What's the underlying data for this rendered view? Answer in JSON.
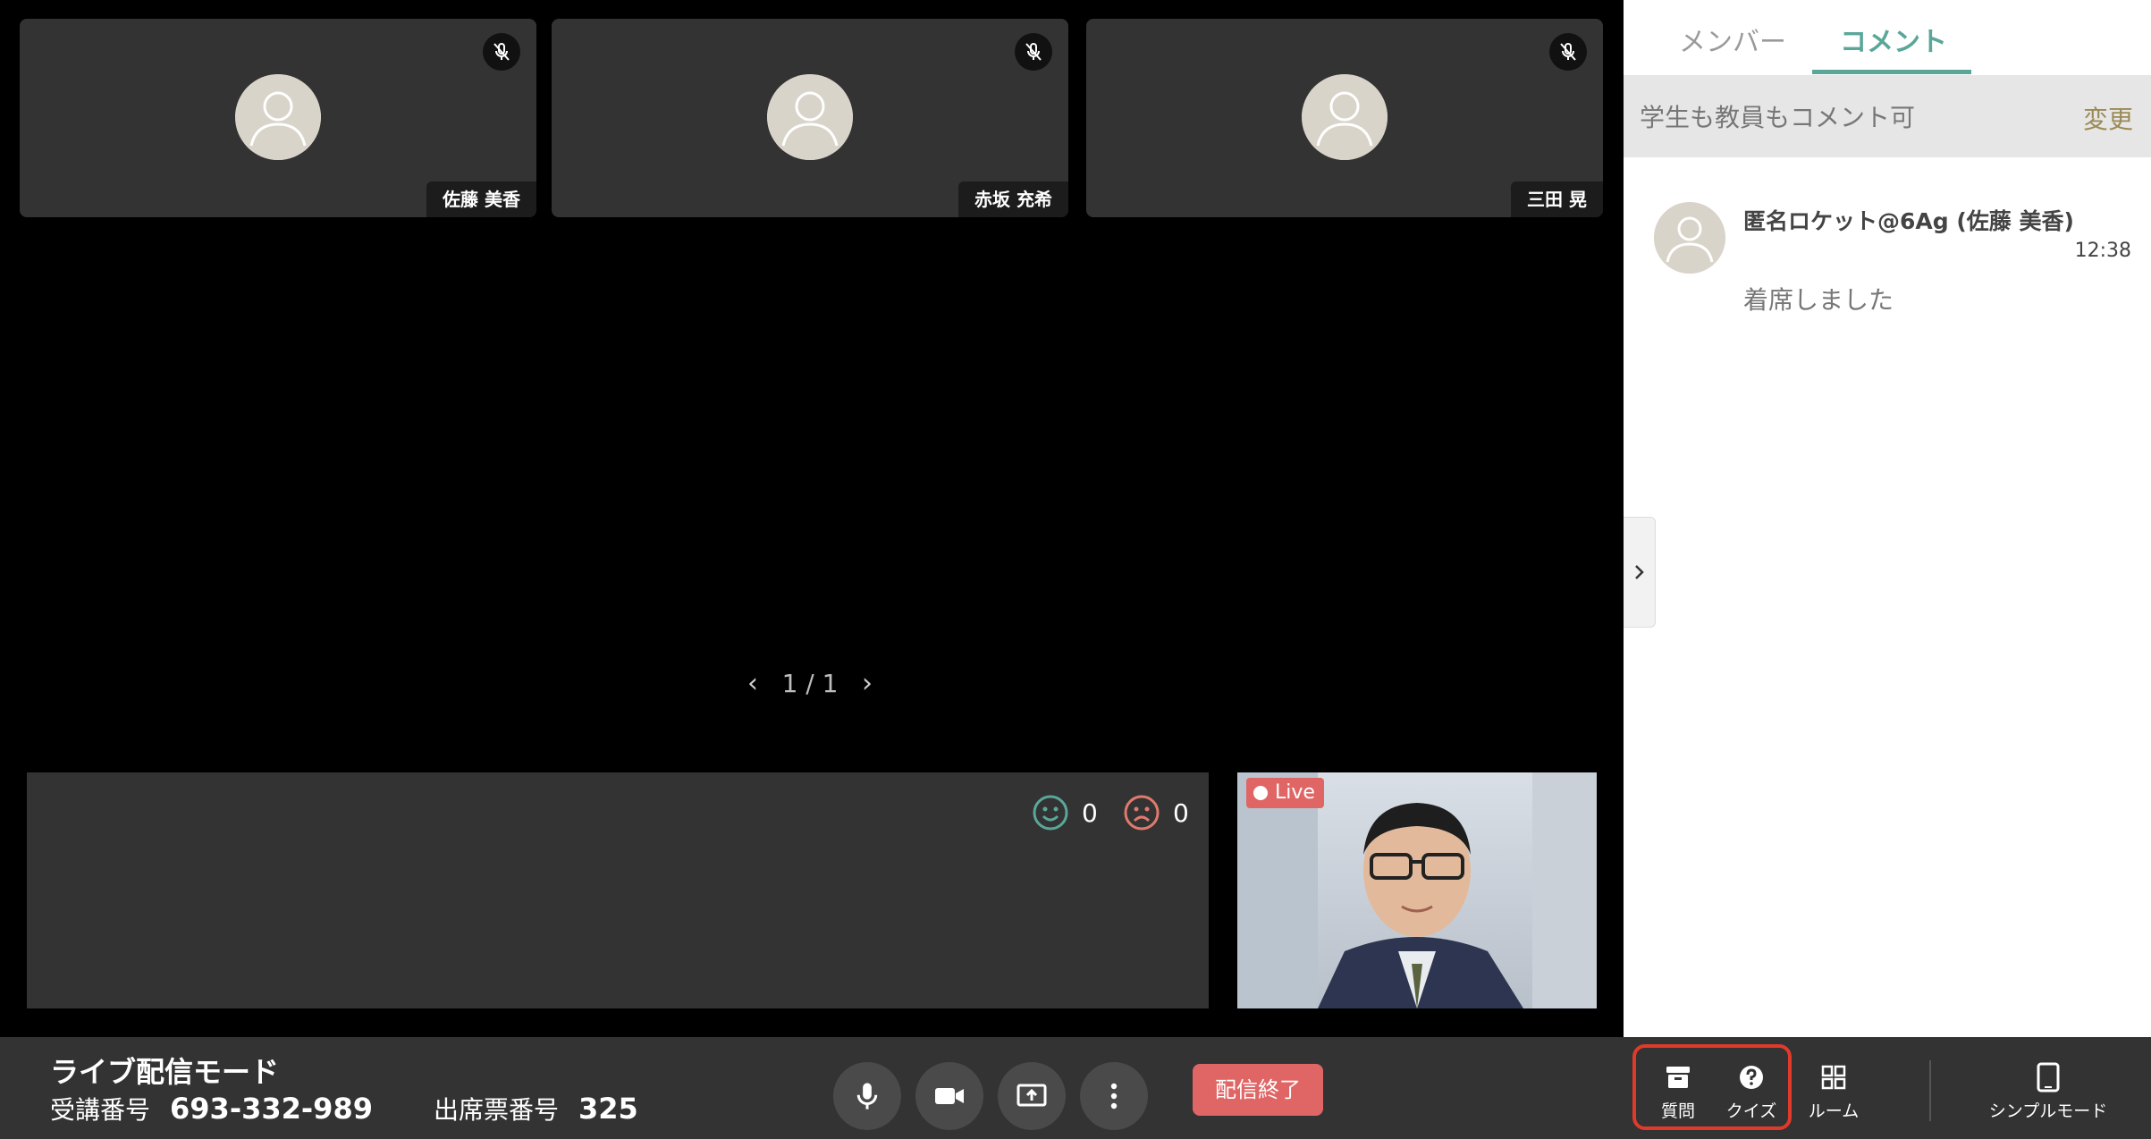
{
  "participants": [
    {
      "name": "佐藤 美香"
    },
    {
      "name": "赤坂 充希"
    },
    {
      "name": "三田 晃"
    }
  ],
  "pager": {
    "label": "1 / 1"
  },
  "reactions": {
    "happy": "0",
    "sad": "0"
  },
  "self_view": {
    "live_label": "Live"
  },
  "bottom": {
    "mode_title": "ライブ配信モード",
    "course_label": "受講番号",
    "course_number": "693-332-989",
    "attendance_label": "出席票番号",
    "attendance_number": "325",
    "end_button": "配信終了",
    "tools": {
      "question": "質問",
      "quiz": "クイズ",
      "room": "ルーム",
      "simple_mode": "シンプルモード"
    }
  },
  "panel": {
    "tabs": {
      "members": "メンバー",
      "comments": "コメント"
    },
    "permission_text": "学生も教員もコメント可",
    "change_label": "変更",
    "comments": [
      {
        "author": "匿名ロケット@6Ag (佐藤 美香)",
        "time": "12:38",
        "text": "着席しました"
      }
    ]
  },
  "colors": {
    "accent": "#5aa79a",
    "end_button": "#e06666",
    "live_badge": "#e06666",
    "highlight": "#e03a2a",
    "happy": "#5aa79a",
    "sad": "#e07a6e"
  },
  "icons": {
    "mute": "mic-off-icon",
    "mic": "mic-icon",
    "camera": "video-camera-icon",
    "share": "screen-share-icon",
    "more": "more-vertical-icon",
    "question": "inbox-icon",
    "quiz": "help-circle-icon",
    "room": "grid-icon",
    "simple": "tablet-icon"
  }
}
